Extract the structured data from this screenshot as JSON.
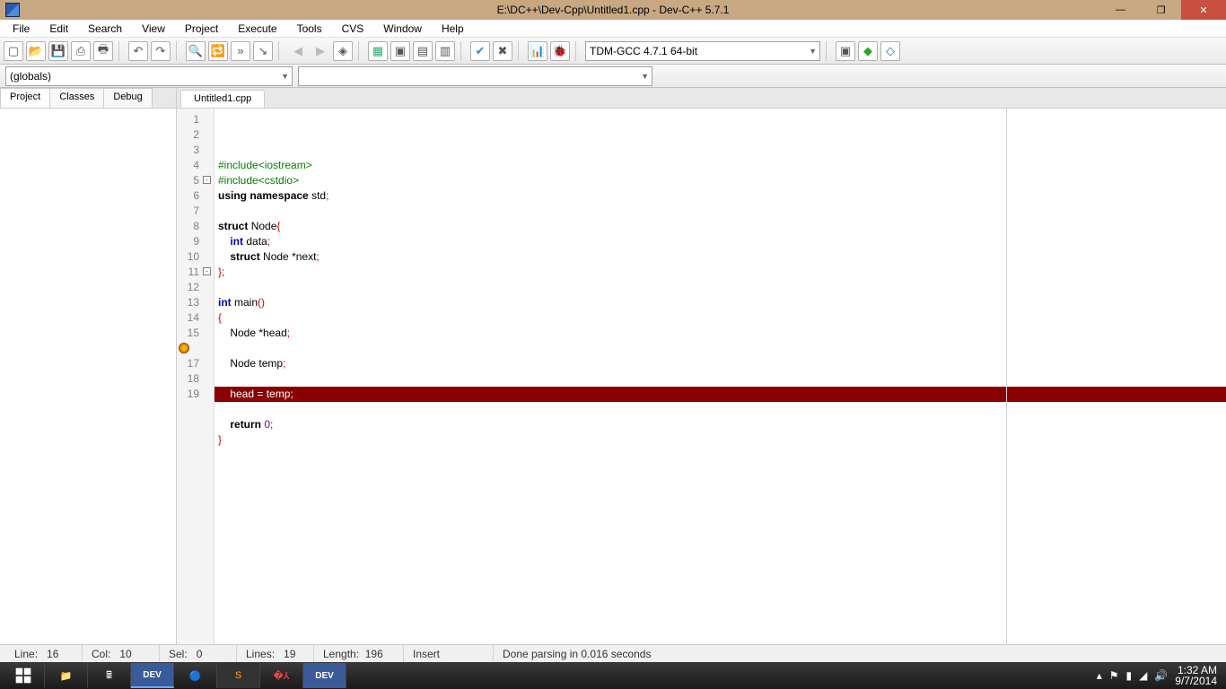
{
  "title": "E:\\DC++\\Dev-Cpp\\Untitled1.cpp - Dev-C++ 5.7.1",
  "menu": [
    "File",
    "Edit",
    "Search",
    "View",
    "Project",
    "Execute",
    "Tools",
    "CVS",
    "Window",
    "Help"
  ],
  "scope_combo": "(globals)",
  "compiler_combo": "TDM-GCC 4.7.1 64-bit",
  "side_tabs": [
    "Project",
    "Classes",
    "Debug"
  ],
  "active_side_tab": 0,
  "editor_tab": "Untitled1.cpp",
  "code_lines": [
    {
      "n": 1,
      "fold": null,
      "err": false,
      "html": "<span class='hl-green'>#include&lt;iostream&gt;</span>"
    },
    {
      "n": 2,
      "fold": null,
      "err": false,
      "html": "<span class='hl-green'>#include&lt;cstdio&gt;</span>"
    },
    {
      "n": 3,
      "fold": null,
      "err": false,
      "html": "<span class='hl-kw'>using</span> <span class='hl-kw'>namespace</span> <span class='hl-id'>std</span><span class='hl-brace'>;</span>"
    },
    {
      "n": 4,
      "fold": null,
      "err": false,
      "html": ""
    },
    {
      "n": 5,
      "fold": "-",
      "err": false,
      "html": "<span class='hl-kw'>struct</span> <span class='hl-id'>Node</span><span class='hl-brace'>{</span>"
    },
    {
      "n": 6,
      "fold": null,
      "err": false,
      "html": "    <span class='hl-type'>int</span> <span class='hl-id'>data</span><span class='hl-brace'>;</span>"
    },
    {
      "n": 7,
      "fold": null,
      "err": false,
      "html": "    <span class='hl-kw'>struct</span> <span class='hl-id'>Node</span> <span class='hl-op'>*</span><span class='hl-id'>next</span><span class='hl-brace'>;</span>"
    },
    {
      "n": 8,
      "fold": null,
      "err": false,
      "html": "<span class='hl-brace'>};</span>"
    },
    {
      "n": 9,
      "fold": null,
      "err": false,
      "html": ""
    },
    {
      "n": 10,
      "fold": null,
      "err": false,
      "html": "<span class='hl-type'>int</span> <span class='hl-id'>main</span><span class='hl-brace'>()</span>"
    },
    {
      "n": 11,
      "fold": "-",
      "err": false,
      "html": "<span class='hl-brace'>{</span>"
    },
    {
      "n": 12,
      "fold": null,
      "err": false,
      "html": "    <span class='hl-id'>Node</span> <span class='hl-op'>*</span><span class='hl-id'>head</span><span class='hl-brace'>;</span>"
    },
    {
      "n": 13,
      "fold": null,
      "err": false,
      "html": ""
    },
    {
      "n": 14,
      "fold": null,
      "err": false,
      "html": "    <span class='hl-id'>Node</span> <span class='hl-id'>temp</span><span class='hl-brace'>;</span>"
    },
    {
      "n": 15,
      "fold": null,
      "err": false,
      "html": ""
    },
    {
      "n": 16,
      "fold": null,
      "err": true,
      "html": "    head = temp;"
    },
    {
      "n": 17,
      "fold": null,
      "err": false,
      "html": ""
    },
    {
      "n": 18,
      "fold": null,
      "err": false,
      "html": "    <span class='hl-kw'>return</span> <span class='hl-num'>0</span><span class='hl-brace'>;</span>"
    },
    {
      "n": 19,
      "fold": null,
      "err": false,
      "html": "<span class='hl-brace'>}</span>"
    }
  ],
  "status": {
    "line_lbl": "Line:",
    "line": "16",
    "col_lbl": "Col:",
    "col": "10",
    "sel_lbl": "Sel:",
    "sel": "0",
    "lines_lbl": "Lines:",
    "lines": "19",
    "len_lbl": "Length:",
    "len": "196",
    "mode": "Insert",
    "parse": "Done parsing in 0.016 seconds"
  },
  "tray": {
    "time": "1:32 AM",
    "date": "9/7/2014"
  }
}
